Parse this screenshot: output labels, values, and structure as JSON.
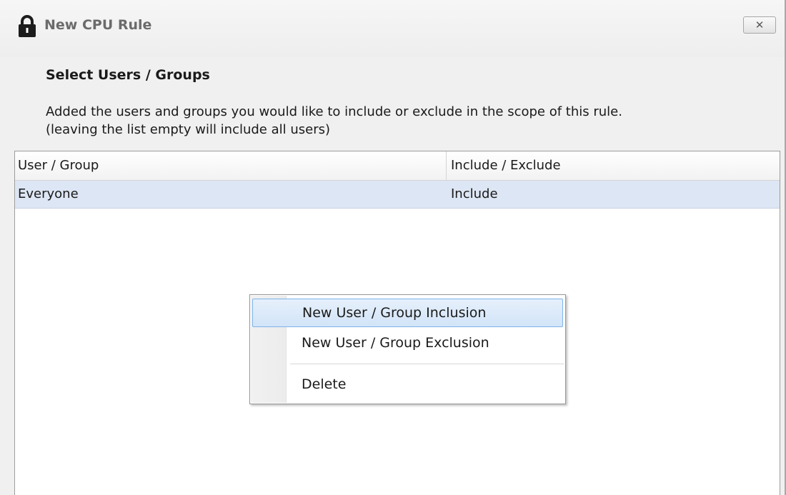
{
  "window": {
    "title": "New CPU Rule",
    "close_label": "✕",
    "title_icon": "lock-icon"
  },
  "header": {
    "heading": "Select Users / Groups",
    "description_line1": "Added the users and groups you would like to include or exclude in the scope of this rule.",
    "description_line2": "(leaving the list empty will include all users)"
  },
  "table": {
    "columns": [
      "User / Group",
      "Include / Exclude"
    ],
    "rows": [
      {
        "user": "Everyone",
        "mode": "Include"
      }
    ]
  },
  "context_menu": {
    "items": [
      {
        "label": "New User / Group Inclusion",
        "highlighted": true
      },
      {
        "label": "New User / Group Exclusion",
        "highlighted": false
      },
      {
        "label": "Delete",
        "highlighted": false
      }
    ]
  },
  "colors": {
    "selected_row": "#dde6f4",
    "menu_highlight_border": "#7eb4ea"
  }
}
